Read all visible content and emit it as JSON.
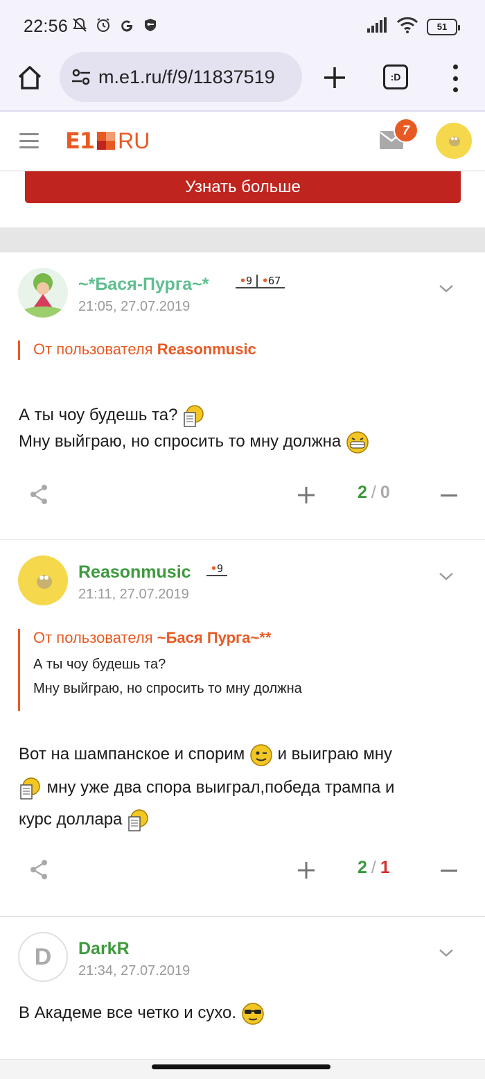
{
  "status_bar": {
    "time": "22:56",
    "battery": "51"
  },
  "browser": {
    "url": "m.e1.ru/f/9/11837519",
    "tabs_label": ":D"
  },
  "site": {
    "logo_left": "E1",
    "logo_right": "RU",
    "mail_badge": "7",
    "brand_color": "#e85a24"
  },
  "promo": {
    "button_label": "Узнать больше"
  },
  "posts": [
    {
      "author": "~*Бася-Пурга~*",
      "date": "21:05, 27.07.2019",
      "rank_a": "9",
      "rank_b": "67",
      "quote_prefix": "От пользователя ",
      "quote_user": "Reasonmusic",
      "line1": "А ты чоу будешь та?",
      "line2": "Мну выйграю, но спросить то мну должна",
      "score_plus": "2",
      "score_minus": "0"
    },
    {
      "author": "Reasonmusic",
      "date": "21:11, 27.07.2019",
      "rank_a": "9",
      "quote_prefix": "От пользователя ",
      "quote_user": "~Бася Пурга~**",
      "quote_line1": "А ты чоу будешь та?",
      "quote_line2": "Мну выйграю, но спросить то мну должна",
      "line1a": "Вот на шампанское и спорим",
      "line1b": "и выиграю мну",
      "line2": "мну уже два спора выиграл,победа трампа и",
      "line3": "курс доллара",
      "score_plus": "2",
      "score_minus": "1"
    },
    {
      "author": "DarkR",
      "avatar_letter": "D",
      "date": "21:34, 27.07.2019",
      "line1": "В Академе все четко и сухо."
    }
  ],
  "score_separator": "/"
}
